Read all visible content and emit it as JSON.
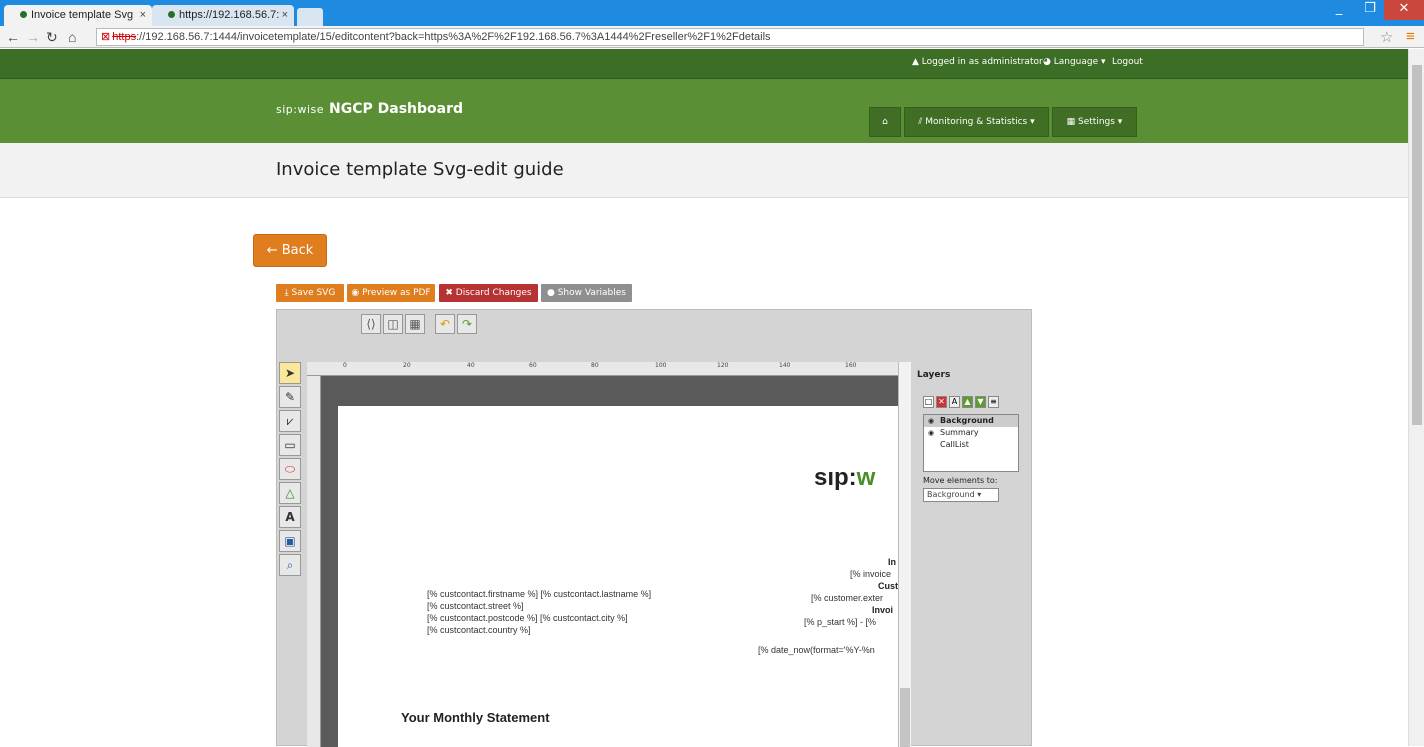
{
  "browser": {
    "tabs": [
      {
        "label": "Invoice template Svg"
      },
      {
        "label": "https://192.168.56.7:"
      }
    ],
    "url_scheme": "https",
    "url_rest": "://192.168.56.7:1444/invoicetemplate/15/editcontent?back=https%3A%2F%2F192.168.56.7%3A1444%2Freseller%2F1%2Fdetails"
  },
  "topbar": {
    "logged_in": "▲ Logged in as administrator",
    "language": "◕ Language ▾",
    "logout": "Logout"
  },
  "header": {
    "logo_mark": "sip:wise",
    "logo_text": "NGCP Dashboard",
    "nav": {
      "home": "⌂",
      "monitoring": "⫽ Monitoring & Statistics ▾",
      "settings": "▦ Settings ▾"
    }
  },
  "page": {
    "title": "Invoice template Svg-edit guide",
    "back_label": "← Back",
    "toolbar": {
      "save": "⤓ Save SVG",
      "preview": "◉ Preview as PDF",
      "discard": "✖ Discard Changes",
      "variables": "● Show Variables"
    }
  },
  "editor": {
    "ruler_ticks": [
      "0",
      "20",
      "40",
      "60",
      "80",
      "100",
      "120",
      "140",
      "160"
    ],
    "paper": {
      "address_lines": [
        "[% custcontact.firstname %] [% custcontact.lastname %]",
        "[% custcontact.street %]",
        "[% custcontact.postcode %] [% custcontact.city %]",
        "[% custcontact.country %]"
      ],
      "right_lines": [
        {
          "text": "In",
          "bold": true
        },
        {
          "text": "[% invoice",
          "bold": false
        },
        {
          "text": "Cust",
          "bold": true
        },
        {
          "text": "[% customer.exter",
          "bold": false
        },
        {
          "text": "Invoi",
          "bold": true
        },
        {
          "text": "[% p_start %] - [%",
          "bold": false
        },
        {
          "text": "[% date_now(format='%Y-%n",
          "bold": false
        }
      ],
      "logo_sip": "sıp:",
      "logo_w": "w",
      "statement": "Your Monthly Statement"
    },
    "layers": {
      "title": "Layers",
      "items": [
        {
          "name": "Background",
          "current": true
        },
        {
          "name": "Summary",
          "current": false
        },
        {
          "name": "CallList",
          "current": false
        }
      ],
      "move_label": "Move elements to:",
      "move_value": "Background ▾"
    }
  }
}
